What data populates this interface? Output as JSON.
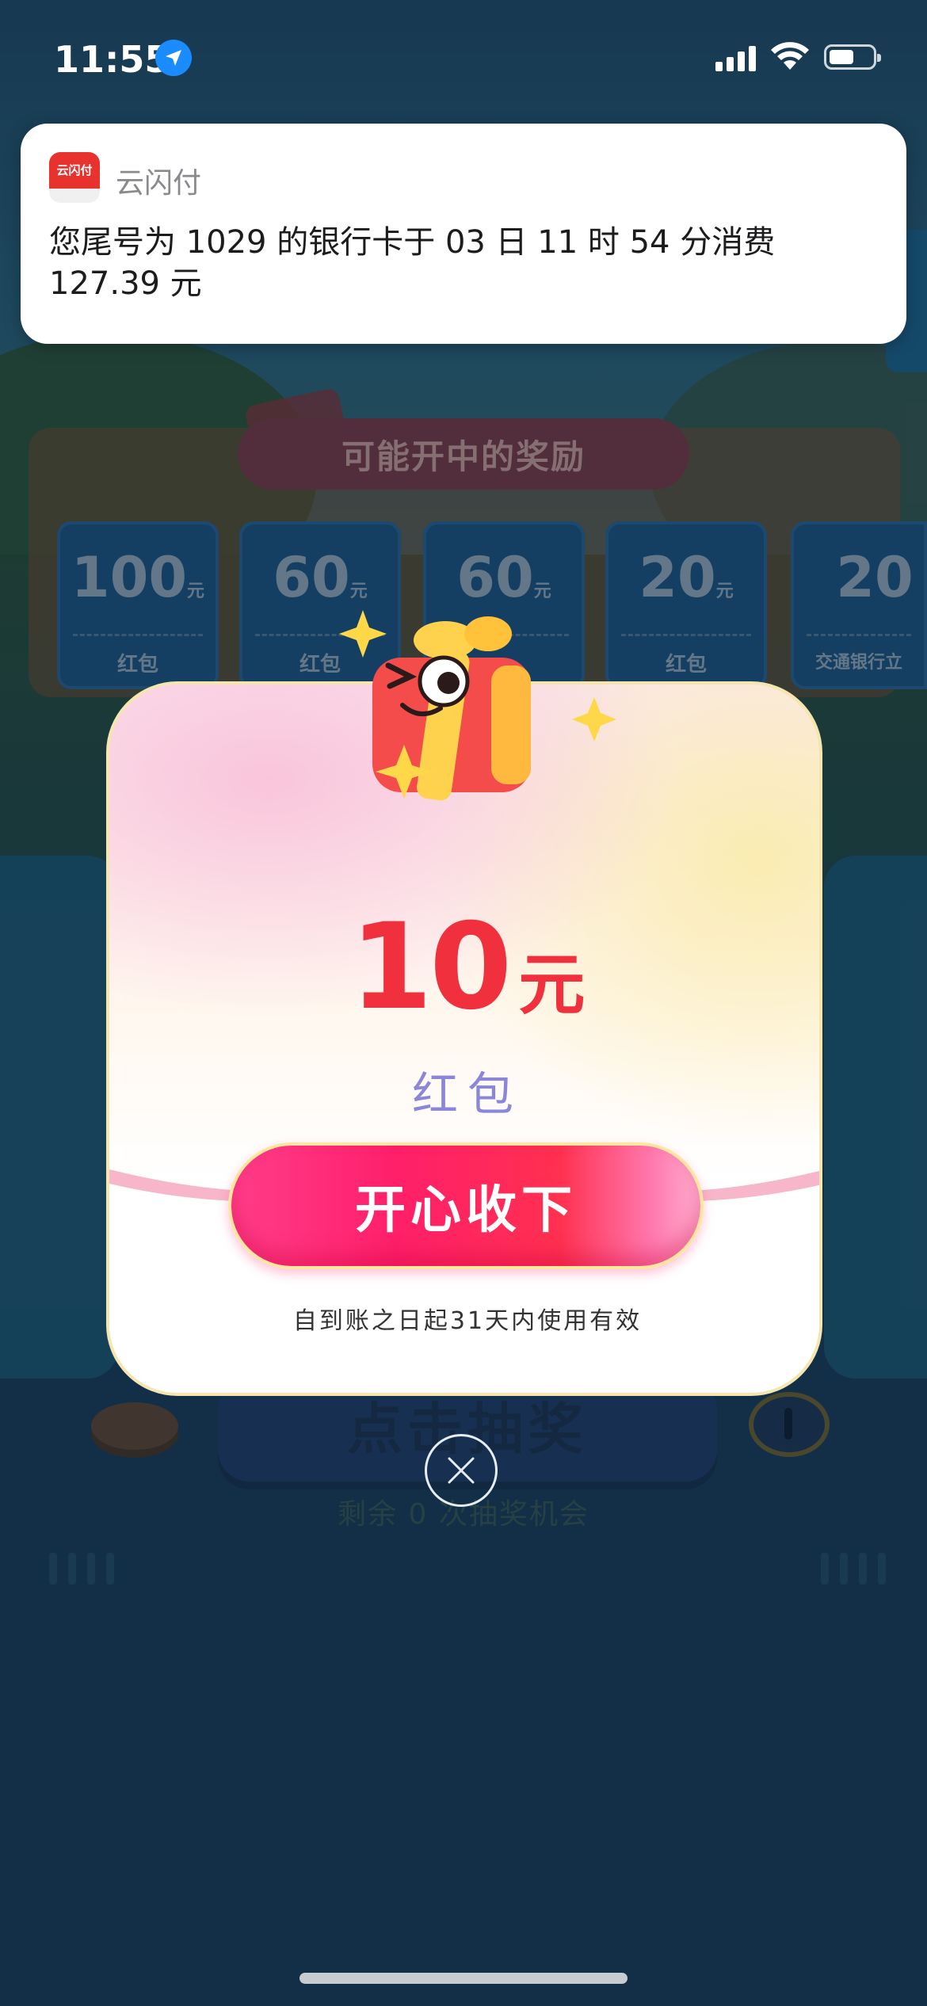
{
  "status_bar": {
    "time": "11:55",
    "icons": [
      "location-arrow-icon",
      "cellular-signal-icon",
      "wifi-icon",
      "battery-icon"
    ]
  },
  "notification": {
    "app_name": "云闪付",
    "app_icon_text": "云闪付",
    "message": "您尾号为 1029 的银行卡于 03 日 11 时 54 分消费 127.39 元"
  },
  "background": {
    "rewards_title": "可能开中的奖励",
    "rewards": [
      {
        "amount": "100",
        "unit": "元",
        "label": "红包"
      },
      {
        "amount": "60",
        "unit": "元",
        "label": "红包"
      },
      {
        "amount": "60",
        "unit": "元",
        "label": ""
      },
      {
        "amount": "20",
        "unit": "元",
        "label": "红包"
      },
      {
        "amount": "20",
        "unit": "",
        "label": "交通银行立"
      }
    ],
    "draw_button": "点击抽奖",
    "remaining_text": "剩余 0 次抽奖机会"
  },
  "modal": {
    "amount": "10",
    "unit": "元",
    "type": "红包",
    "cta_label": "开心收下",
    "validity": "自到账之日起31天内使用有效"
  },
  "colors": {
    "accent_red": "#f0313d",
    "label_purple": "#8c86d8",
    "cta_pink": "#ff1f6a",
    "notification_icon_red": "#e8322e"
  }
}
